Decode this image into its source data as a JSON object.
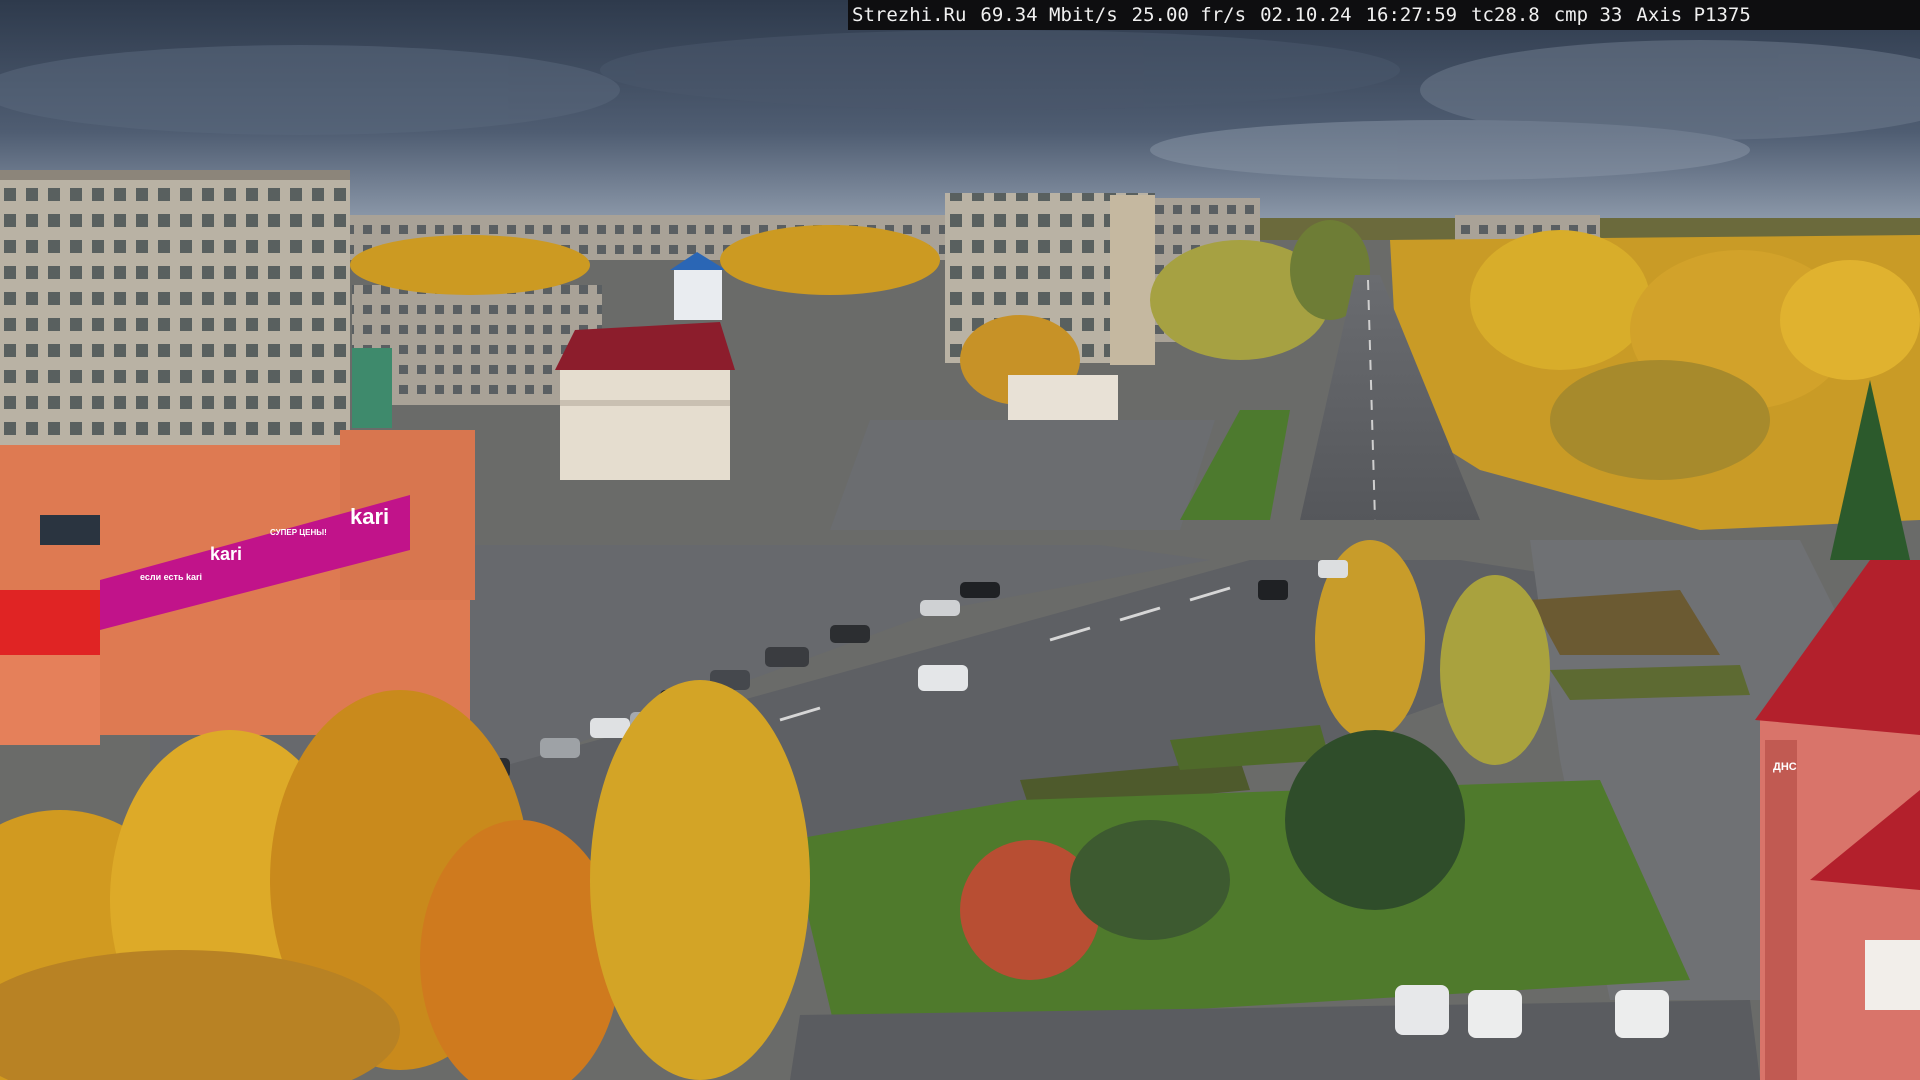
{
  "osd": {
    "site": "Strezhi.Ru",
    "bitrate": "69.34 Mbit/s",
    "framerate": "25.00 fr/s",
    "date": "02.10.24",
    "time": "16:27:59",
    "tc": "tc28.8",
    "cmp": "cmp 33",
    "camera": "Axis P1375"
  },
  "signs": {
    "store_brand": "kari",
    "store_brand_lower": "kari",
    "store_slogan": "СУПЕР ЦЕНЫ!",
    "store_slogan_sub": "если есть kari",
    "pharmacy": "ДНС"
  },
  "palette": {
    "sky_top": "#3a4658",
    "sky_bottom": "#8f9cae",
    "asphalt": "#5d5f63",
    "foliage_gold": "#d9a21b",
    "foliage_orange": "#c9711d",
    "grass": "#4f7a2c",
    "store_magenta": "#c1138a",
    "store_orange": "#de7a52",
    "roof_red": "#b3202c"
  }
}
